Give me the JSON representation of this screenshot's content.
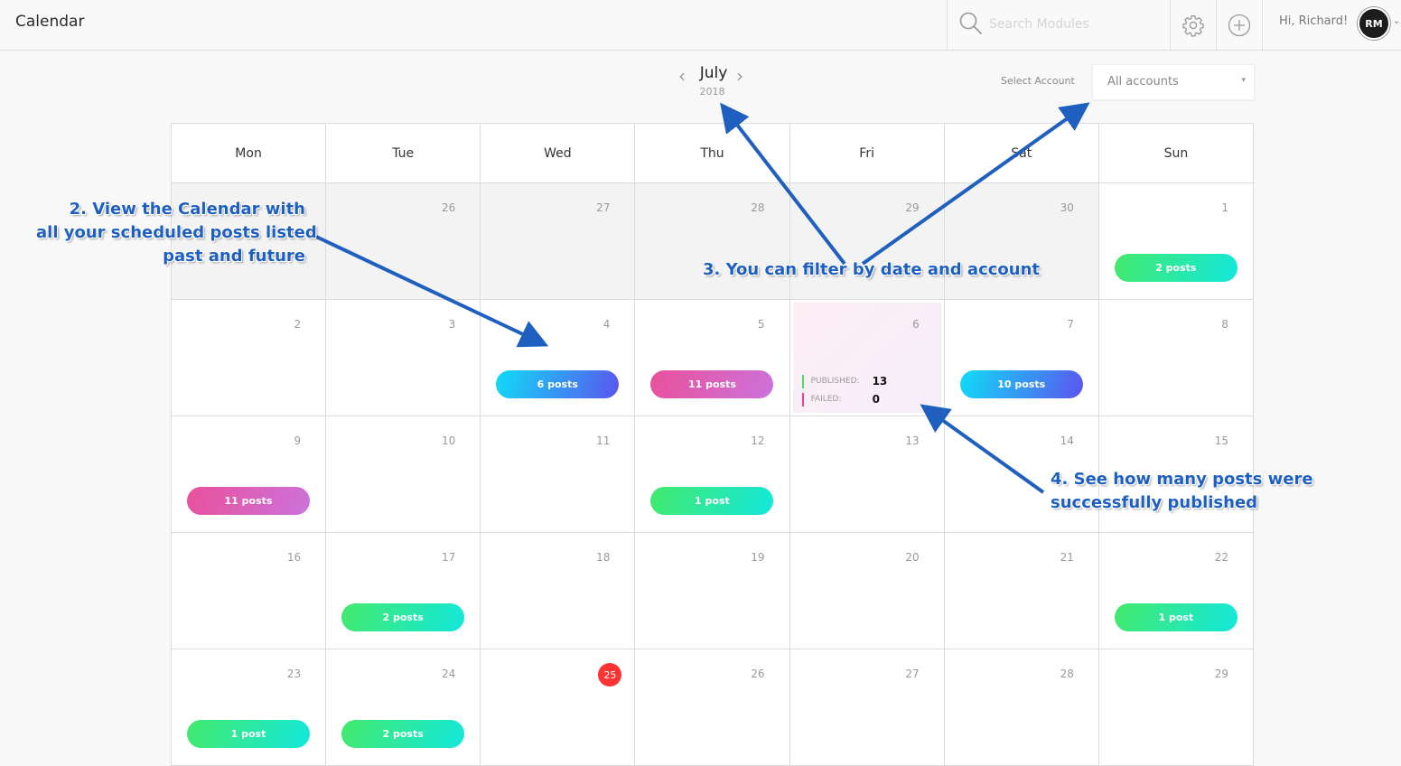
{
  "header": {
    "title": "Calendar",
    "search_placeholder": "Search Modules",
    "greeting": "Hi, Richard!",
    "avatar_initials": "RM",
    "icons": [
      "search-icon",
      "gear-icon",
      "plus-circle-icon",
      "chevron-down-icon"
    ]
  },
  "nav": {
    "month": "July",
    "year": "2018",
    "prev_icon": "‹",
    "next_icon": "›"
  },
  "account_filter": {
    "label": "Select Account",
    "value": "All accounts",
    "caret": "▾"
  },
  "calendar": {
    "weekdays": [
      "Mon",
      "Tue",
      "Wed",
      "Thu",
      "Fri",
      "Sat",
      "Sun"
    ],
    "weeks": [
      [
        {
          "day": "26",
          "other": true
        },
        {
          "day": "27",
          "other": true
        },
        {
          "day": "28",
          "other": true
        },
        {
          "day": "29",
          "other": true
        },
        {
          "day": "30",
          "other": true
        },
        {
          "day": "1",
          "pill": "2 posts",
          "color": "green"
        }
      ],
      [
        {
          "day": "2"
        },
        {
          "day": "3"
        },
        {
          "day": "4",
          "pill": "6 posts",
          "color": "blue"
        },
        {
          "day": "5",
          "pill": "11 posts",
          "color": "pink"
        },
        {
          "day": "6",
          "highlight": true
        },
        {
          "day": "7",
          "pill": "10 posts",
          "color": "blue"
        },
        {
          "day": "8"
        }
      ],
      [
        {
          "day": "9",
          "pill": "11 posts",
          "color": "pink"
        },
        {
          "day": "10"
        },
        {
          "day": "11"
        },
        {
          "day": "12",
          "pill": "1 post",
          "color": "green"
        },
        {
          "day": "13"
        },
        {
          "day": "14"
        },
        {
          "day": "15"
        }
      ],
      [
        {
          "day": "16"
        },
        {
          "day": "17",
          "pill": "2 posts",
          "color": "green"
        },
        {
          "day": "18"
        },
        {
          "day": "19"
        },
        {
          "day": "20"
        },
        {
          "day": "21"
        },
        {
          "day": "22",
          "pill": "1 post",
          "color": "green"
        }
      ],
      [
        {
          "day": "23",
          "pill": "1 post",
          "color": "green"
        },
        {
          "day": "24",
          "pill": "2 posts",
          "color": "green"
        },
        {
          "day": "25",
          "today": true
        },
        {
          "day": "26"
        },
        {
          "day": "27"
        },
        {
          "day": "28"
        },
        {
          "day": "29"
        }
      ]
    ],
    "stats": {
      "published_label": "PUBLISHED:",
      "published_value": "13",
      "failed_label": "FAILED:",
      "failed_value": "0",
      "published_color": "#4cd964",
      "failed_color": "#e6448f"
    }
  },
  "annotations": {
    "a2": [
      "2. View the Calendar with",
      "all your scheduled posts listed",
      "past and future"
    ],
    "a3": "3. You can filter by date and account",
    "a4": [
      "4. See how many posts were",
      "successfully published"
    ],
    "color": "#1e5fc0"
  }
}
